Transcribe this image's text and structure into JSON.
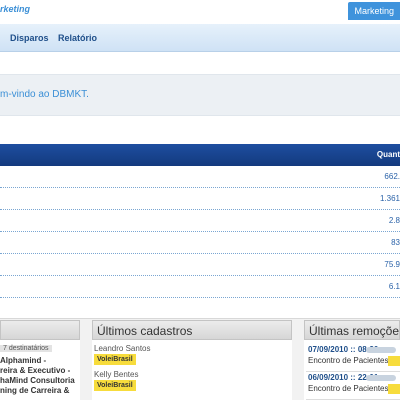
{
  "header": {
    "brand": "rketing",
    "top_button": "Marketing"
  },
  "nav": {
    "items": [
      "Disparos",
      "Relatório"
    ]
  },
  "welcome": {
    "text": "m-vindo ao DBMKT."
  },
  "table": {
    "header_label": "Quant",
    "rows": [
      "662.",
      "1.361",
      "2.8",
      "83",
      "75.9",
      "6.1"
    ]
  },
  "panels": {
    "left": {
      "badge": "7 destinatários",
      "lines": [
        "Alphamind -",
        "reira & Executivo -",
        "haMind Consultoria",
        "ning de Carreira &"
      ]
    },
    "cadastros": {
      "title": "Últimos cadastros",
      "entries": [
        {
          "name": "Leandro Santos",
          "tag": "VoleiBrasil"
        },
        {
          "name": "Kelly Bentes",
          "tag": "VoleiBrasil"
        }
      ]
    },
    "remocoes": {
      "title": "Últimas remoçõe",
      "entries": [
        {
          "date": "07/09/2010 :: 08:30",
          "desc": "Encontro de Pacientes."
        },
        {
          "date": "06/09/2010 :: 22:01",
          "desc": "Encontro de Pacientes."
        }
      ]
    }
  }
}
